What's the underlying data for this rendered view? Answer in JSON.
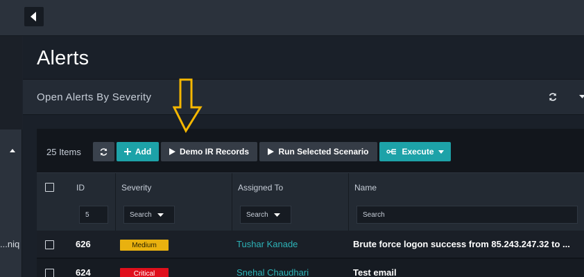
{
  "page": {
    "title": "Alerts"
  },
  "nav": {
    "truncated_label": "niq..."
  },
  "severity_panel": {
    "title": "Open Alerts By Severity"
  },
  "toolbar": {
    "items_count": "25 Items",
    "add_label": "Add",
    "demo_label": "Demo IR Records",
    "run_label": "Run Selected Scenario",
    "execute_label": "Execute"
  },
  "columns": {
    "id": {
      "label": "ID",
      "filter_value": "5"
    },
    "severity": {
      "label": "Severity",
      "filter_placeholder": "Search"
    },
    "assigned_to": {
      "label": "Assigned To",
      "filter_placeholder": "Search"
    },
    "name": {
      "label": "Name",
      "filter_placeholder": "Search"
    }
  },
  "rows": [
    {
      "id": "626",
      "severity": "Medium",
      "assigned_to": "Tushar Kanade",
      "name": "Brute force logon success from 85.243.247.32 to ..."
    },
    {
      "id": "624",
      "severity": "Critical",
      "assigned_to": "Snehal Chaudhari",
      "name": "Test email"
    }
  ],
  "colors": {
    "accent": "#1da2a8",
    "medium": "#e9b10f",
    "critical": "#e0101c",
    "annotation_arrow": "#f5b700"
  },
  "icons": [
    "caret-left-icon",
    "refresh-icon",
    "plus-icon",
    "play-icon",
    "execute-icon",
    "caret-down-icon",
    "arrow-down-annotation"
  ]
}
